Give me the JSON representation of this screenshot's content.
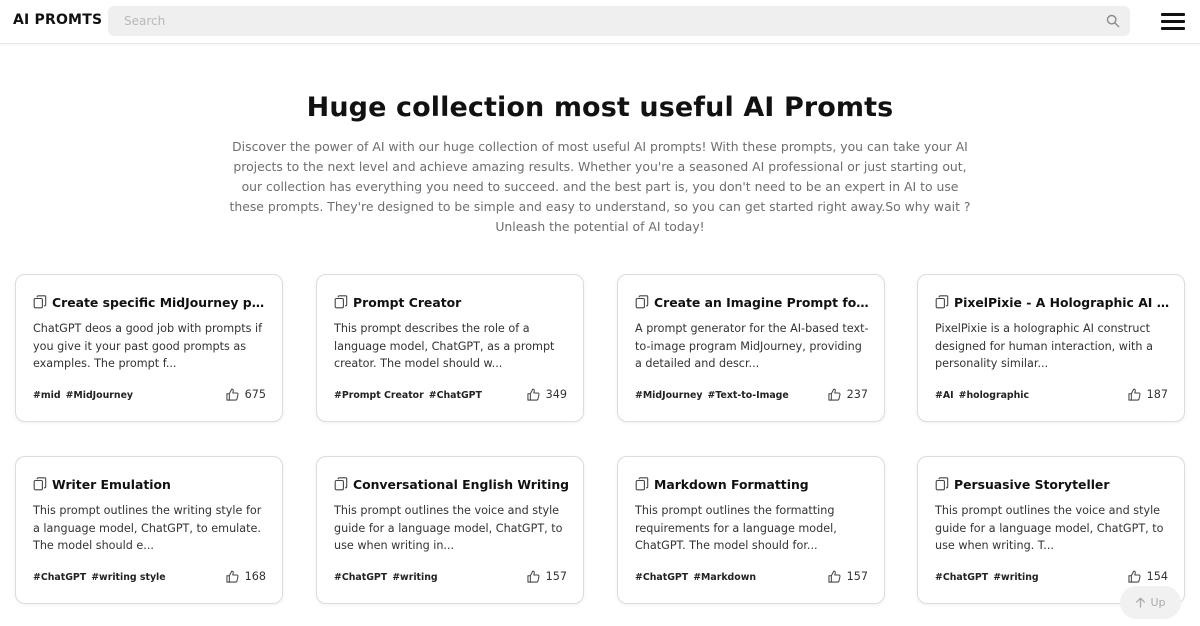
{
  "header": {
    "logo": "AI PROMTS",
    "search_placeholder": "Search",
    "search_icon": "search-icon",
    "menu_icon": "hamburger-menu-icon"
  },
  "hero": {
    "title": "Huge collection most useful AI Promts",
    "description": "Discover the power of AI with our huge collection of most useful AI prompts! With these prompts, you can take your AI projects to the next level and achieve amazing results. Whether you're a seasoned AI professional or just starting out, our collection has everything you need to succeed. and the best part is, you don't need to be an expert in AI to use these prompts. They're designed to be simple and easy to understand, so you can get started right away.So why wait ? Unleash the potential of AI today!"
  },
  "cards": [
    {
      "title": "Create specific MidJourney prompts",
      "description": "ChatGPT deos a good job with prompts if you give it your past good prompts as examples. The prompt f...",
      "tags": [
        "#mid",
        "#MidJourney"
      ],
      "likes": "675"
    },
    {
      "title": "Prompt Creator",
      "description": "This prompt describes the role of a language model, ChatGPT, as a prompt creator. The model should w...",
      "tags": [
        "#Prompt Creator",
        "#ChatGPT"
      ],
      "likes": "349"
    },
    {
      "title": "Create an Imagine Prompt for MidJourney",
      "description": "A prompt generator for the AI-based text-to-image program MidJourney, providing a detailed and descr...",
      "tags": [
        "#MidJourney",
        "#Text-to-Image"
      ],
      "likes": "237"
    },
    {
      "title": "PixelPixie - A Holographic AI Construct",
      "description": "PixelPixie is a holographic AI construct designed for human interaction, with a personality similar...",
      "tags": [
        "#AI",
        "#holographic"
      ],
      "likes": "187"
    },
    {
      "title": "Writer Emulation",
      "description": "This prompt outlines the writing style for a language model, ChatGPT, to emulate. The model should e...",
      "tags": [
        "#ChatGPT",
        "#writing style"
      ],
      "likes": "168"
    },
    {
      "title": "Conversational English Writing",
      "description": "This prompt outlines the voice and style guide for a language model, ChatGPT, to use when writing in...",
      "tags": [
        "#ChatGPT",
        "#writing"
      ],
      "likes": "157"
    },
    {
      "title": "Markdown Formatting",
      "description": "This prompt outlines the formatting requirements for a language model, ChatGPT. The model should for...",
      "tags": [
        "#ChatGPT",
        "#Markdown"
      ],
      "likes": "157"
    },
    {
      "title": "Persuasive Storyteller",
      "description": "This prompt outlines the voice and style guide for a language model, ChatGPT, to use when writing. T...",
      "tags": [
        "#ChatGPT",
        "#writing"
      ],
      "likes": "154"
    }
  ],
  "scroll_top": {
    "label": "Up",
    "icon": "arrow-up-icon"
  }
}
